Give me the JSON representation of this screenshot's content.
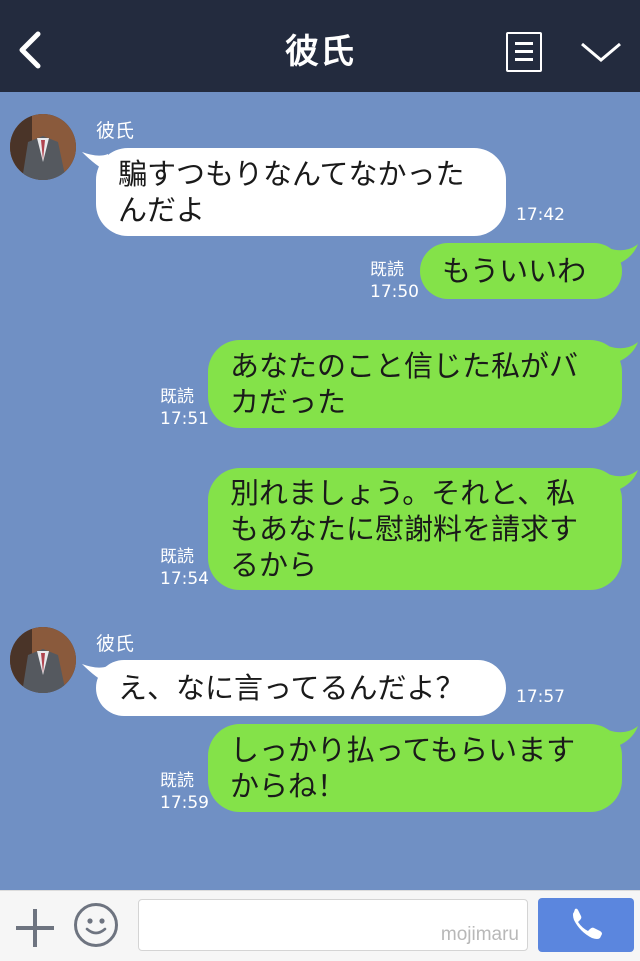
{
  "header": {
    "title": "彼氏"
  },
  "messages": [
    {
      "sender": "彼氏",
      "text": "騙すつもりなんてなかった\nんだよ",
      "time": "17:42"
    },
    {
      "read": "既読",
      "text": "もういいわ",
      "time": "17:50"
    },
    {
      "read": "既読",
      "text": "あなたのこと信じた私がバ\nカだった",
      "time": "17:51"
    },
    {
      "read": "既読",
      "text": "別れましょう。それと、私\nもあなたに慰謝料を請求す\nるから",
      "time": "17:54"
    },
    {
      "sender": "彼氏",
      "text": "え、なに言ってるんだよ？",
      "time": "17:57"
    },
    {
      "read": "既読",
      "text": "しっかり払ってもらいます\nからね！",
      "time": "17:59"
    }
  ],
  "bottom": {
    "watermark": "mojimaru"
  },
  "colors": {
    "header": "#232b3e",
    "background": "#7090c4",
    "sent_bubble": "#84e249",
    "received_bubble": "#ffffff",
    "send_button": "#5b86de"
  },
  "icons": [
    "back-icon",
    "menu-icon",
    "chevron-down-icon",
    "plus-icon",
    "emoji-icon",
    "phone-icon"
  ]
}
